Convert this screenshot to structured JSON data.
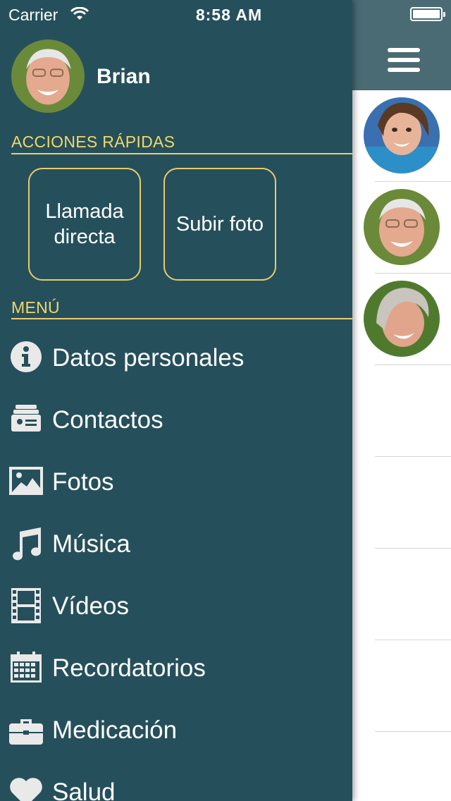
{
  "status_bar": {
    "carrier": "Carrier",
    "time": "8:58 AM"
  },
  "profile": {
    "name": "Brian"
  },
  "quick_actions": {
    "title": "ACCIONES RÁPIDAS",
    "buttons": [
      {
        "label_line1": "Llamada",
        "label_line2": "directa"
      },
      {
        "label": "Subir foto"
      }
    ]
  },
  "menu": {
    "title": "MENÚ",
    "items": [
      {
        "label": "Datos personales",
        "icon": "info-icon"
      },
      {
        "label": "Contactos",
        "icon": "contacts-icon"
      },
      {
        "label": "Fotos",
        "icon": "photo-icon"
      },
      {
        "label": "Música",
        "icon": "music-note-icon"
      },
      {
        "label": "Vídeos",
        "icon": "film-icon"
      },
      {
        "label": "Recordatorios",
        "icon": "calendar-icon"
      },
      {
        "label": "Medicación",
        "icon": "briefcase-icon"
      },
      {
        "label": "Salud",
        "icon": "heart-icon"
      }
    ]
  },
  "colors": {
    "drawer_bg": "#264f5c",
    "accent": "#f1d866",
    "header_bg": "#4a6b73"
  }
}
